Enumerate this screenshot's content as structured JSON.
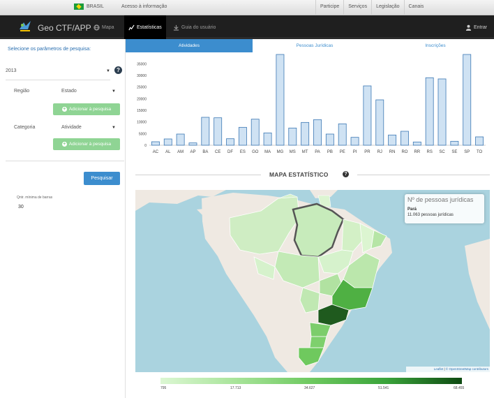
{
  "govbar": {
    "brasil": "BRASIL",
    "acesso": "Acesso à informação",
    "links": [
      "Participe",
      "Serviços",
      "Legislação",
      "Canais"
    ]
  },
  "navbar": {
    "brand": "Geo CTF/APP",
    "items": [
      {
        "label": "Mapa",
        "icon": "globe-icon"
      },
      {
        "label": "Estatísticas",
        "icon": "chart-icon"
      },
      {
        "label": "Guia do usuário",
        "icon": "download-icon"
      }
    ],
    "login": "Entrar"
  },
  "sidebar": {
    "title": "Selecione os parâmetros de pesquisa:",
    "year": "2013",
    "region_label": "Região",
    "state_label": "Estado",
    "category_label": "Categoria",
    "activity_label": "Atividade",
    "add_button": "Adicionar à pesquisa",
    "add_button_2": "Adicionar à pesquisa",
    "search_button": "Pesquisar",
    "qtd_label": "Qntr. mínima de barras",
    "qtd_value": "30"
  },
  "tabs": [
    "Atividades",
    "Pessoas Jurídicas",
    "Inscrições"
  ],
  "chart_data": {
    "type": "bar",
    "categories": [
      "AC",
      "AL",
      "AM",
      "AP",
      "BA",
      "CE",
      "DF",
      "ES",
      "GO",
      "MA",
      "MG",
      "MS",
      "MT",
      "PA",
      "PB",
      "PE",
      "PI",
      "PR",
      "RJ",
      "RN",
      "RO",
      "RR",
      "RS",
      "SC",
      "SE",
      "SP",
      "TO"
    ],
    "values": [
      1500,
      2700,
      4800,
      1000,
      12000,
      11800,
      2800,
      7700,
      11200,
      5300,
      39000,
      7400,
      9800,
      11000,
      4800,
      9200,
      3400,
      25500,
      19500,
      4400,
      6000,
      1400,
      29000,
      28500,
      1700,
      39000,
      3600
    ],
    "yticks": [
      "0",
      "5000",
      "10000",
      "15000",
      "20000",
      "25000",
      "30000",
      "35000"
    ],
    "ylim": [
      0,
      39000
    ],
    "color": "#cfe2f3",
    "stroke": "#3c78b4"
  },
  "section": {
    "title": "MAPA ESTATÍSTICO"
  },
  "map": {
    "info_title": "Nº de pessoas jurídicas",
    "info_state": "Pará",
    "info_value": "11.063 pessoas jurídicas",
    "attribution_leaflet": "Leaflet",
    "attribution_osm": "© OpenStreetMap contributors",
    "water_color": "#a8cfd6",
    "land_color": "#efe9e2"
  },
  "legend": {
    "ticks": [
      "795",
      "17.713",
      "34.627",
      "51.541",
      "68.455"
    ]
  }
}
